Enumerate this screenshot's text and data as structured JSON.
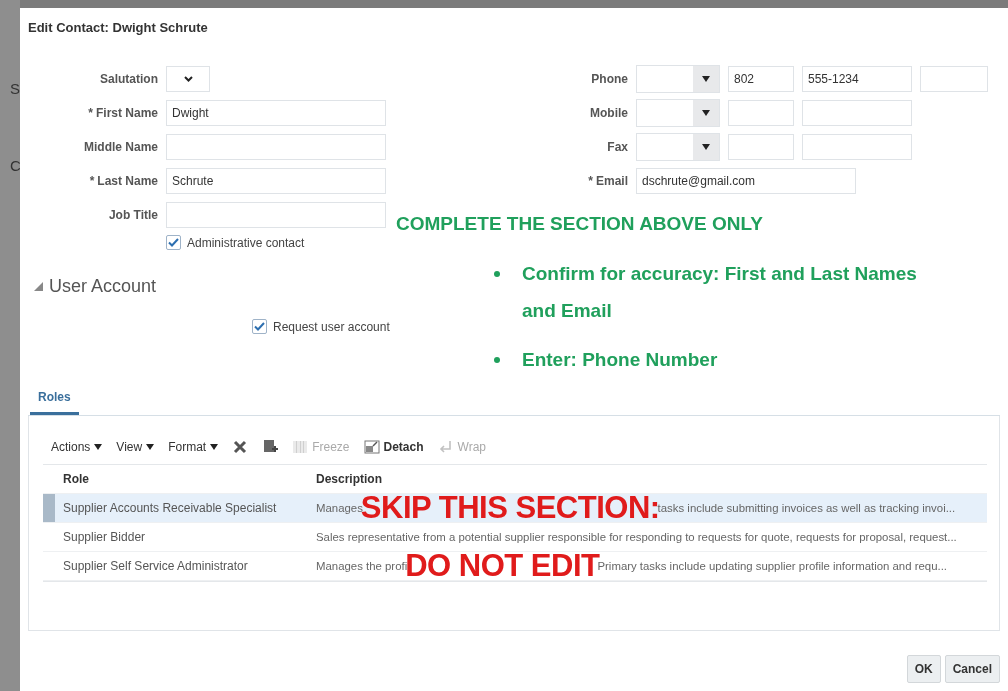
{
  "backdrop_letters": [
    "S",
    "C"
  ],
  "dialog": {
    "title": "Edit Contact: Dwight Schrute"
  },
  "left_fields": [
    {
      "kind": "select",
      "label": "Salutation"
    },
    {
      "kind": "text",
      "label": "First Name",
      "required_mark": "*",
      "value": "Dwight"
    },
    {
      "kind": "text",
      "label": "Middle Name"
    },
    {
      "kind": "text",
      "label": "Last Name",
      "required_mark": "*",
      "value": "Schrute"
    },
    {
      "kind": "text",
      "label": "Job Title"
    }
  ],
  "administrative_contact": {
    "label": "Administrative contact",
    "checked": true
  },
  "right_fields": [
    {
      "kind": "phone",
      "label": "Phone",
      "area_code": "802",
      "number": "555-1234",
      "extension_box": true
    },
    {
      "kind": "phone",
      "label": "Mobile",
      "extension_box": false
    },
    {
      "kind": "phone",
      "label": "Fax",
      "extension_box": false
    },
    {
      "kind": "email",
      "label": "Email",
      "required_mark": "*",
      "value": "dschrute@gmail.com"
    }
  ],
  "instructions": {
    "heading": "COMPLETE THE SECTION ABOVE ONLY",
    "bullets": [
      "Confirm for accuracy: First and Last Names and Email",
      "Enter: Phone Number"
    ]
  },
  "user_account": {
    "title": "User Account",
    "expanded": true,
    "request": {
      "label": "Request user account",
      "checked": true
    }
  },
  "tabs": [
    {
      "label": "Roles",
      "selected": true
    }
  ],
  "toolbar": [
    {
      "kind": "menu",
      "label": "Actions",
      "disabled": false
    },
    {
      "kind": "menu",
      "label": "View",
      "disabled": false
    },
    {
      "kind": "menu",
      "label": "Format",
      "disabled": false
    },
    {
      "kind": "delete",
      "disabled": false
    },
    {
      "kind": "add",
      "disabled": false
    },
    {
      "kind": "freeze",
      "label": "Freeze",
      "disabled": true
    },
    {
      "kind": "detach",
      "label": "Detach",
      "disabled": false
    },
    {
      "kind": "wrap",
      "label": "Wrap",
      "disabled": true
    }
  ],
  "table": {
    "columns": [
      "Role",
      "Description"
    ],
    "rows": [
      {
        "role": "Supplier Accounts Receivable Specialist",
        "description": [
          "Manages",
          "tasks include submitting invoices as well as tracking invoi..."
        ],
        "annotation": "SKIP THIS SECTION:",
        "selected": true
      },
      {
        "role": "Supplier Bidder",
        "description": [
          "Sales representative from a potential supplier responsible for responding to requests for quote, requests for proposal, request..."
        ],
        "selected": false
      },
      {
        "role": "Supplier Self Service Administrator",
        "description": [
          "Manages the profi",
          "Primary tasks include updating supplier profile information and requ..."
        ],
        "annotation": "DO NOT EDIT",
        "selected": false
      }
    ]
  },
  "buttons": [
    "OK",
    "Cancel"
  ]
}
